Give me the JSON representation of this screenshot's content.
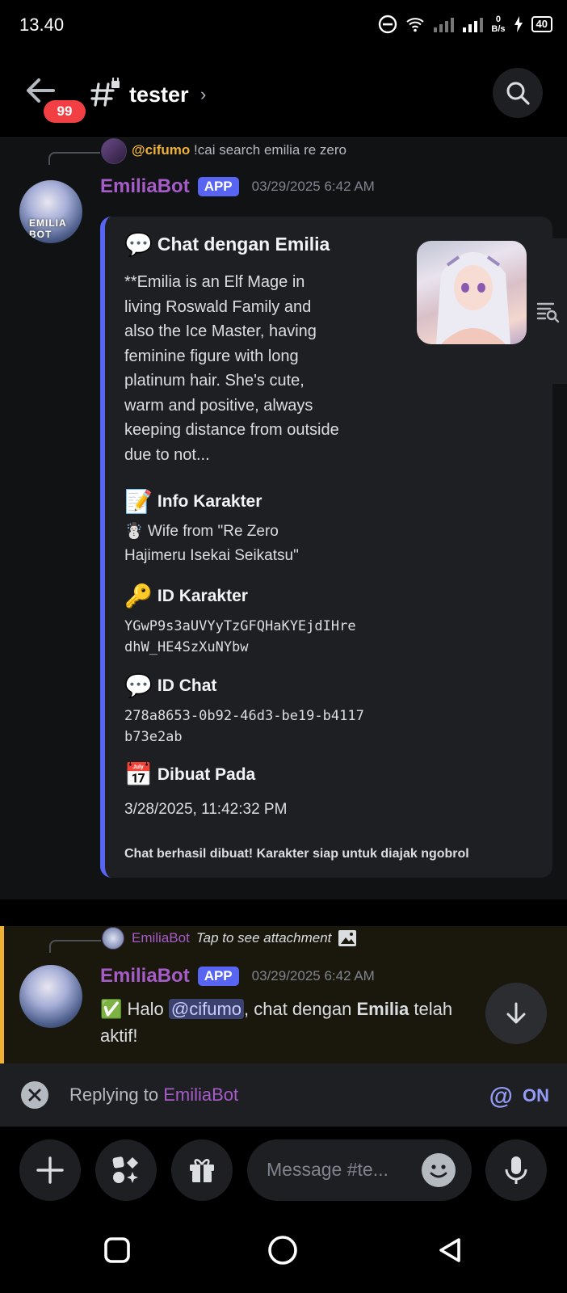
{
  "status_bar": {
    "time": "13.40",
    "net_speed_value": "0",
    "net_speed_unit": "B/s",
    "battery": "40"
  },
  "header": {
    "unread_count": "99",
    "channel_name": "tester"
  },
  "message1": {
    "reply_to": {
      "username": "@cifumo",
      "text": "!cai search emilia re zero"
    },
    "username": "EmiliaBot",
    "app_tag": "APP",
    "timestamp": "03/29/2025 6:42 AM",
    "avatar_text": "EMILIA BOT",
    "embed": {
      "title_emoji": "💬",
      "title": "Chat dengan Emilia",
      "description": "**Emilia is an Elf Mage in living Roswald Family and also the Ice Master, having feminine figure with long platinum hair. She's cute, warm and positive, always keeping distance from outside due to not...",
      "fields": [
        {
          "emoji": "📝",
          "name": "Info Karakter",
          "value": "☃️ Wife from \"Re Zero Hajimeru Isekai Seikatsu\""
        },
        {
          "emoji": "🔑",
          "name": "ID Karakter",
          "value": "YGwP9s3aUVYyTzGFQHaKYEjdIHredhW_HE4SzXuNYbw"
        },
        {
          "emoji": "💬",
          "name": "ID Chat",
          "value": "278a8653-0b92-46d3-be19-b4117b73e2ab"
        },
        {
          "emoji": "📅",
          "name": "Dibuat Pada",
          "value": "3/28/2025, 11:42:32 PM"
        }
      ],
      "footer": "Chat berhasil dibuat! Karakter siap untuk diajak ngobrol"
    }
  },
  "message2": {
    "reply_to": {
      "username": "EmiliaBot",
      "text": "Tap to see attachment"
    },
    "username": "EmiliaBot",
    "app_tag": "APP",
    "timestamp": "03/29/2025 6:42 AM",
    "text_prefix": "✅ Halo ",
    "mention": "@cifumo",
    "text_mid": ", chat dengan ",
    "bold_name": "Emilia",
    "text_suffix": " telah aktif!"
  },
  "reply_bar": {
    "prefix": "Replying to ",
    "name": "EmiliaBot",
    "mention_toggle": "ON"
  },
  "composer": {
    "placeholder": "Message #te..."
  },
  "colors": {
    "accent": "#5865f2",
    "bot_name": "#a65cc8",
    "mention_bg": "#3c4270",
    "highlight_border": "#f0b232"
  }
}
